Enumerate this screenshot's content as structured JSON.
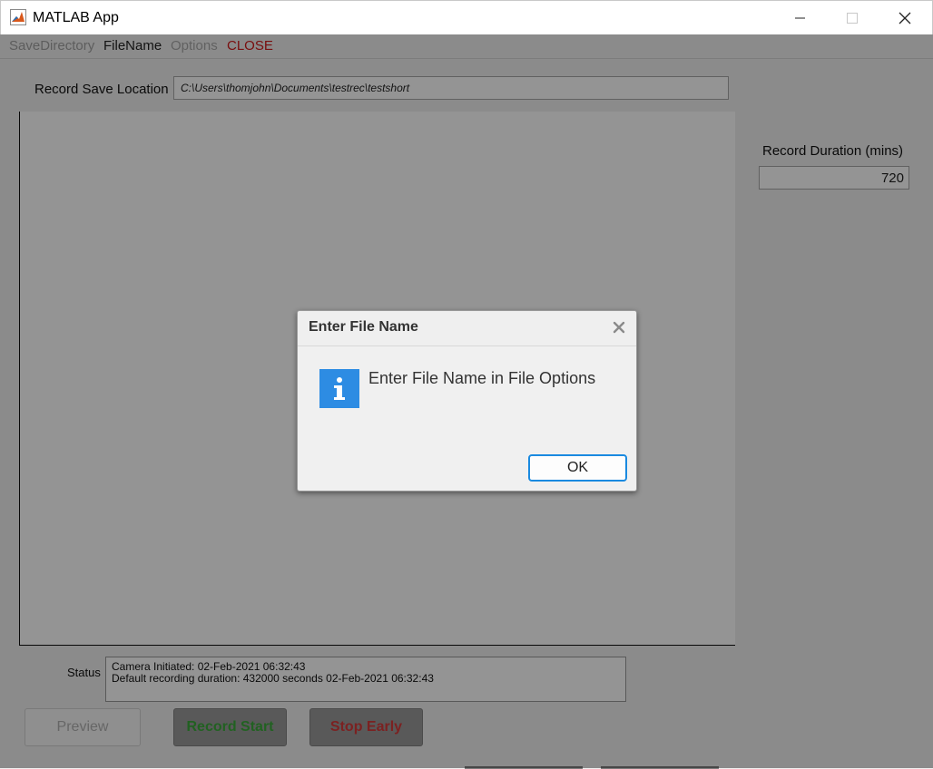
{
  "window": {
    "title": "MATLAB App"
  },
  "menu": {
    "save_directory": "SaveDirectory",
    "file_name": "FileName",
    "options": "Options",
    "close": "CLOSE"
  },
  "record": {
    "save_location_label": "Record Save Location",
    "save_location_value": "C:\\Users\\thomjohn\\Documents\\testrec\\testshort",
    "duration_label": "Record Duration (mins)",
    "duration_value": "720"
  },
  "status": {
    "label": "Status",
    "line1": "Camera Initiated: 02-Feb-2021 06:32:43",
    "line2": "Default recording duration: 432000 seconds 02-Feb-2021 06:32:43"
  },
  "buttons": {
    "preview": "Preview",
    "record_start": "Record Start",
    "stop_early": "Stop Early"
  },
  "dialog": {
    "title": "Enter File Name",
    "message": "Enter File Name in File Options",
    "ok": "OK"
  },
  "colors": {
    "menu_close": "#d01a1a",
    "record_start_text": "#3aa83a",
    "stop_early_text": "#d43a3a",
    "info_icon": "#2d8ce3",
    "ok_border": "#1a8ae0"
  },
  "icons": {
    "app": "matlab-logo-icon",
    "minimize": "minimize-icon",
    "maximize": "maximize-icon",
    "close": "close-icon",
    "dialog_close": "close-x-icon",
    "info": "info-icon"
  }
}
